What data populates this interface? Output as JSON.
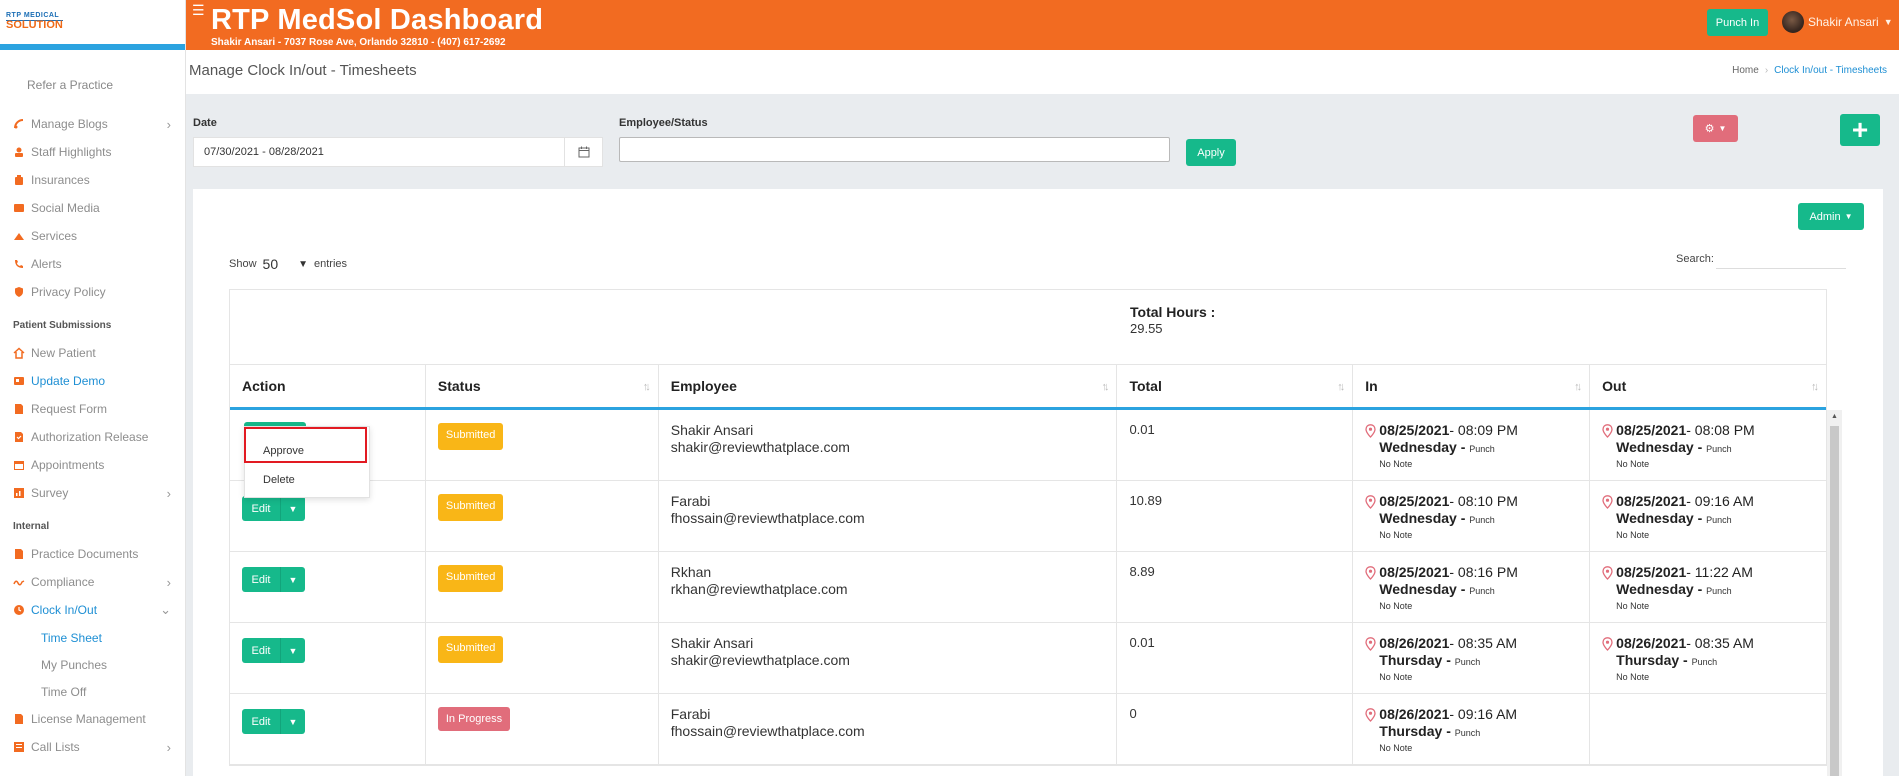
{
  "app": {
    "brand_title": "RTP MedSol Dashboard",
    "address": "Shakir Ansari - 7037 Rose Ave, Orlando 32810 - (407) 617-2692",
    "logo_line1": "RTP MEDICAL",
    "logo_line2": "SOLUTION",
    "accent_color": "#f26b21",
    "action_color": "#16b98b"
  },
  "header": {
    "punch_label": "Punch In",
    "user_name": "Shakir Ansari"
  },
  "sidebar": {
    "refer": "Refer a Practice",
    "main_items": [
      {
        "label": "Manage Blogs",
        "icon": "blog-icon",
        "chevron": true
      },
      {
        "label": "Staff Highlights",
        "icon": "staff-icon"
      },
      {
        "label": "Insurances",
        "icon": "insurance-icon"
      },
      {
        "label": "Social Media",
        "icon": "social-media-icon"
      },
      {
        "label": "Services",
        "icon": "services-icon"
      },
      {
        "label": "Alerts",
        "icon": "phone-icon"
      },
      {
        "label": "Privacy Policy",
        "icon": "shield-icon"
      }
    ],
    "section_patient": "Patient Submissions",
    "patient_items": [
      {
        "label": "New Patient",
        "icon": "home-icon"
      },
      {
        "label": "Update Demo",
        "icon": "id-card-icon"
      },
      {
        "label": "Request Form",
        "icon": "file-icon"
      },
      {
        "label": "Authorization Release",
        "icon": "check-file-icon"
      },
      {
        "label": "Appointments",
        "icon": "calendar-icon"
      },
      {
        "label": "Survey",
        "icon": "chart-icon",
        "chevron": true
      }
    ],
    "section_internal": "Internal",
    "internal_items": [
      {
        "label": "Practice Documents",
        "icon": "document-icon"
      },
      {
        "label": "Compliance",
        "icon": "signature-icon",
        "chevron": true
      },
      {
        "label": "Clock In/Out",
        "icon": "clock-icon",
        "chevron": "down"
      }
    ],
    "clock_sub": [
      "Time Sheet",
      "My Punches",
      "Time Off"
    ],
    "bottom_items": [
      {
        "label": "License Management",
        "icon": "license-icon"
      },
      {
        "label": "Call Lists",
        "icon": "list-icon",
        "chevron": true
      }
    ]
  },
  "page": {
    "title": "Manage Clock In/out - Timesheets",
    "breadcrumb_home": "Home",
    "breadcrumb_current": "Clock In/out - Timesheets"
  },
  "filters": {
    "date_label": "Date",
    "date_value": "07/30/2021 - 08/28/2021",
    "employee_label": "Employee/Status",
    "employee_value": "",
    "apply_label": "Apply"
  },
  "table_controls": {
    "admin_label": "Admin",
    "show_label": "Show",
    "entries_value": "50",
    "entries_label": "entries",
    "search_label": "Search:"
  },
  "summary": {
    "total_hours_label": "Total Hours :",
    "total_hours_value": "29.55"
  },
  "columns": [
    "Action",
    "Status",
    "Employee",
    "Total",
    "In",
    "Out"
  ],
  "action_menu": [
    "Approve",
    "Delete"
  ],
  "edit_label": "Edit",
  "rows": [
    {
      "status": "Submitted",
      "status_kind": "submitted",
      "name": "Shakir Ansari",
      "email": "shakir@reviewthatplace.com",
      "total": "0.01",
      "in_date": "08/25/2021",
      "in_time": " - 08:09 PM",
      "in_day": "Wednesday",
      "in_punch": "Punch",
      "in_note": "No Note",
      "out_date": "08/25/2021",
      "out_time": " - 08:08 PM",
      "out_day": "Wednesday",
      "out_punch": "Punch",
      "out_note": "No Note"
    },
    {
      "status": "Submitted",
      "status_kind": "submitted",
      "name": "Farabi",
      "email": "fhossain@reviewthatplace.com",
      "total": "10.89",
      "in_date": "08/25/2021",
      "in_time": " - 08:10 PM",
      "in_day": "Wednesday",
      "in_punch": "Punch",
      "in_note": "No Note",
      "out_date": "08/25/2021",
      "out_time": " - 09:16 AM",
      "out_day": "Wednesday",
      "out_punch": "Punch",
      "out_note": "No Note"
    },
    {
      "status": "Submitted",
      "status_kind": "submitted",
      "name": "Rkhan",
      "email": "rkhan@reviewthatplace.com",
      "total": "8.89",
      "in_date": "08/25/2021",
      "in_time": " - 08:16 PM",
      "in_day": "Wednesday",
      "in_punch": "Punch",
      "in_note": "No Note",
      "out_date": "08/25/2021",
      "out_time": " - 11:22 AM",
      "out_day": "Wednesday",
      "out_punch": "Punch",
      "out_note": "No Note"
    },
    {
      "status": "Submitted",
      "status_kind": "submitted",
      "name": "Shakir Ansari",
      "email": "shakir@reviewthatplace.com",
      "total": "0.01",
      "in_date": "08/26/2021",
      "in_time": " - 08:35 AM",
      "in_day": "Thursday",
      "in_punch": "Punch",
      "in_note": "No Note",
      "out_date": "08/26/2021",
      "out_time": " - 08:35 AM",
      "out_day": "Thursday",
      "out_punch": "Punch",
      "out_note": "No Note"
    },
    {
      "status": "In Progress",
      "status_kind": "progress",
      "name": "Farabi",
      "email": "fhossain@reviewthatplace.com",
      "total": "0",
      "in_date": "08/26/2021",
      "in_time": " - 09:16 AM",
      "in_day": "Thursday",
      "in_punch": "Punch",
      "in_note": "No Note",
      "out_date": "",
      "out_time": "",
      "out_day": "",
      "out_punch": "",
      "out_note": ""
    }
  ]
}
